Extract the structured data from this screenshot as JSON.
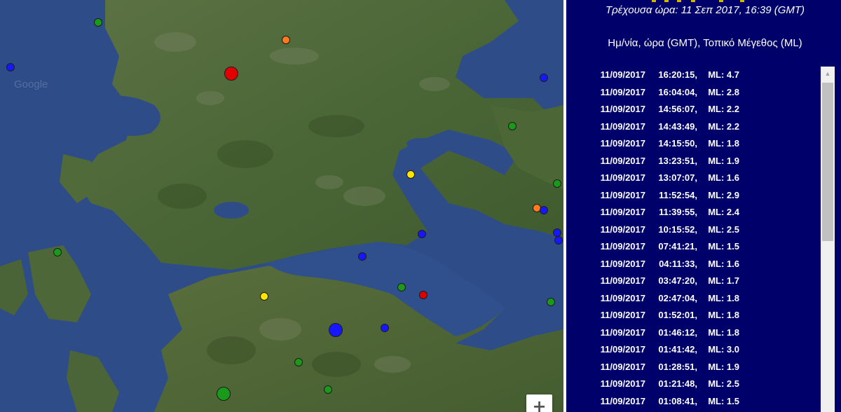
{
  "map": {
    "watermark": "Google",
    "zoom_in_label": "+",
    "quakes": [
      {
        "color": "#e00000",
        "size": "large"
      },
      {
        "color": "#e00000",
        "size": "small"
      },
      {
        "color": "#ff7b1c",
        "size": "small"
      },
      {
        "color": "#ff7b1c",
        "size": "small"
      },
      {
        "color": "#ffe600",
        "size": "small"
      },
      {
        "color": "#ffe600",
        "size": "small"
      },
      {
        "color": "#1717ff",
        "size": "large"
      },
      {
        "color": "#1717ff",
        "size": "small"
      },
      {
        "color": "#1717ff",
        "size": "small"
      },
      {
        "color": "#1717ff",
        "size": "small"
      },
      {
        "color": "#1717ff",
        "size": "small"
      },
      {
        "color": "#1717ff",
        "size": "small"
      },
      {
        "color": "#1717ff",
        "size": "small"
      },
      {
        "color": "#1717ff",
        "size": "small"
      },
      {
        "color": "#1717ff",
        "size": "small"
      },
      {
        "color": "#1a9a1a",
        "size": "large"
      },
      {
        "color": "#1a9a1a",
        "size": "small"
      },
      {
        "color": "#1a9a1a",
        "size": "small"
      },
      {
        "color": "#1a9a1a",
        "size": "small"
      },
      {
        "color": "#1a9a1a",
        "size": "small"
      },
      {
        "color": "#1a9a1a",
        "size": "small"
      },
      {
        "color": "#1a9a1a",
        "size": "small"
      },
      {
        "color": "#1a9a1a",
        "size": "small"
      },
      {
        "color": "#1a9a1a",
        "size": "small"
      }
    ]
  },
  "panel": {
    "current_time": "Τρέχουσα ώρα: 11 Σεπ 2017, 16:39 (GMT)",
    "list_header": "Ημ/νία, ώρα (GMT), Τοπικό Μέγεθος (ML)",
    "magnitude_prefix": "ML:",
    "events": [
      {
        "date": "11/09/2017",
        "time": "16:20:15,",
        "ml": "4.7"
      },
      {
        "date": "11/09/2017",
        "time": "16:04:04,",
        "ml": "2.8"
      },
      {
        "date": "11/09/2017",
        "time": "14:56:07,",
        "ml": "2.2"
      },
      {
        "date": "11/09/2017",
        "time": "14:43:49,",
        "ml": "2.2"
      },
      {
        "date": "11/09/2017",
        "time": "14:15:50,",
        "ml": "1.8"
      },
      {
        "date": "11/09/2017",
        "time": "13:23:51,",
        "ml": "1.9"
      },
      {
        "date": "11/09/2017",
        "time": "13:07:07,",
        "ml": "1.6"
      },
      {
        "date": "11/09/2017",
        "time": "11:52:54,",
        "ml": "2.9"
      },
      {
        "date": "11/09/2017",
        "time": "11:39:55,",
        "ml": "2.4"
      },
      {
        "date": "11/09/2017",
        "time": "10:15:52,",
        "ml": "2.5"
      },
      {
        "date": "11/09/2017",
        "time": "07:41:21,",
        "ml": "1.5"
      },
      {
        "date": "11/09/2017",
        "time": "04:11:33,",
        "ml": "1.6"
      },
      {
        "date": "11/09/2017",
        "time": "03:47:20,",
        "ml": "1.7"
      },
      {
        "date": "11/09/2017",
        "time": "02:47:04,",
        "ml": "1.8"
      },
      {
        "date": "11/09/2017",
        "time": "01:52:01,",
        "ml": "1.8"
      },
      {
        "date": "11/09/2017",
        "time": "01:46:12,",
        "ml": "1.8"
      },
      {
        "date": "11/09/2017",
        "time": "01:41:42,",
        "ml": "3.0"
      },
      {
        "date": "11/09/2017",
        "time": "01:28:51,",
        "ml": "1.9"
      },
      {
        "date": "11/09/2017",
        "time": "01:21:48,",
        "ml": "2.5"
      },
      {
        "date": "11/09/2017",
        "time": "01:08:41,",
        "ml": "1.5"
      }
    ]
  },
  "colors": {
    "panel_bg": "#00006b",
    "sea": "#2f4f8a",
    "land": "#4f6a3a",
    "scrollbar_track": "#f0f0f0",
    "scrollbar_thumb": "#c1c1c1"
  },
  "icons": {
    "scroll_up": "chevron-up-icon",
    "zoom_in": "plus-icon"
  }
}
